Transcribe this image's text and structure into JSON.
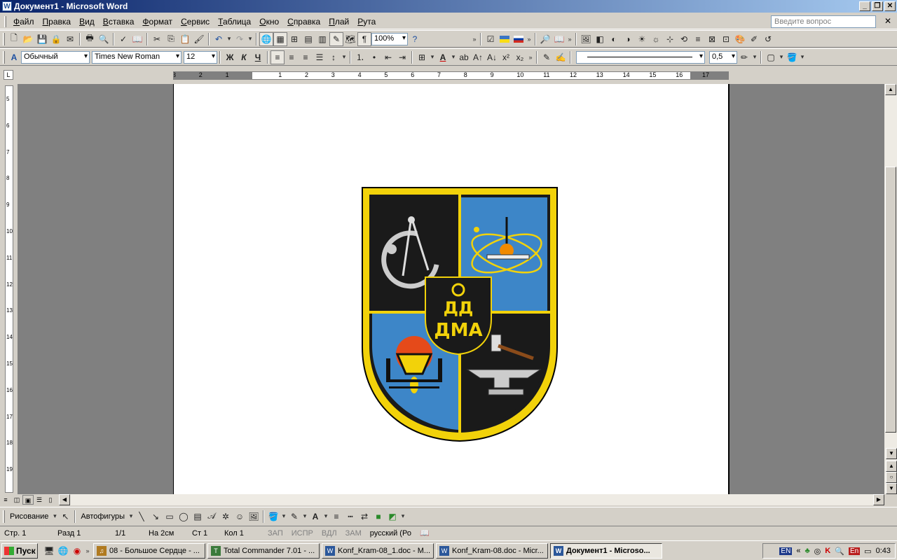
{
  "window": {
    "title": "Документ1 - Microsoft Word",
    "app_icon": "word-icon"
  },
  "menu": {
    "items": [
      "Файл",
      "Правка",
      "Вид",
      "Вставка",
      "Формат",
      "Сервис",
      "Таблица",
      "Окно",
      "Справка",
      "Плай",
      "Рута"
    ],
    "help_placeholder": "Введите вопрос"
  },
  "standard_toolbar": {
    "zoom": "100%"
  },
  "format_toolbar": {
    "style": "Обычный",
    "font": "Times New Roman",
    "size": "12",
    "bold": "Ж",
    "italic": "К",
    "underline": "Ч",
    "line_weight": "0,5"
  },
  "ruler": {
    "h_labels": [
      "3",
      "2",
      "1",
      "",
      "1",
      "2",
      "3",
      "4",
      "5",
      "6",
      "7",
      "8",
      "9",
      "10",
      "11",
      "12",
      "13",
      "14",
      "15",
      "16",
      "17"
    ],
    "v_labels": [
      "5",
      "6",
      "7",
      "8",
      "9",
      "10",
      "11",
      "12",
      "13",
      "14",
      "15",
      "16",
      "17",
      "18",
      "19"
    ]
  },
  "drawing_toolbar": {
    "draw_label": "Рисование",
    "autoshapes_label": "Автофигуры"
  },
  "status": {
    "page": "Стр. 1",
    "section": "Разд 1",
    "pages": "1/1",
    "at": "На 2см",
    "line": "Ст 1",
    "col": "Кол 1",
    "rec": "ЗАП",
    "trk": "ИСПР",
    "ext": "ВДЛ",
    "ovr": "ЗАМ",
    "lang": "русский (Ро"
  },
  "taskbar": {
    "start": "Пуск",
    "tasks": [
      "08 - Большое Сердце - ...",
      "Total Commander 7.01 - ...",
      "Konf_Kram-08_1.doc - M...",
      "Konf_Kram-08.doc - Micr...",
      "Документ1 - Microso..."
    ],
    "lang": "EN",
    "lang2": "En",
    "clock": "0:43"
  },
  "emblem": {
    "letters_top": "ДД",
    "letters_bottom": "ДМА",
    "colors": {
      "gold": "#f2d20a",
      "black": "#1a1a1a",
      "blue": "#3d86c8"
    }
  }
}
